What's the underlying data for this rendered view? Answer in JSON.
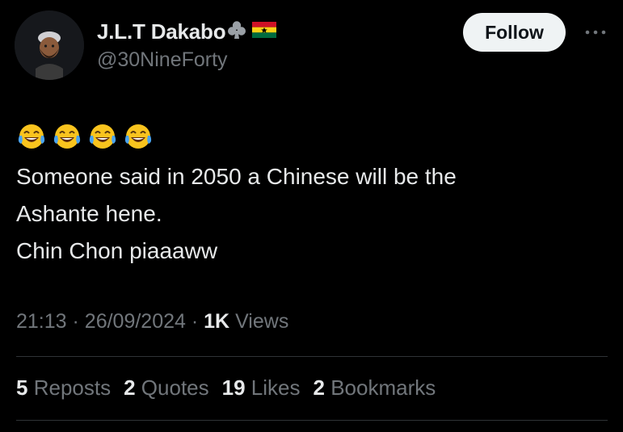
{
  "author": {
    "display_name": "J.L.T Dakabo",
    "handle": "@30NineForty",
    "badges": [
      "club-icon",
      "ghana-flag-icon"
    ]
  },
  "follow_button": {
    "label": "Follow"
  },
  "more_menu": {
    "icon": "more-horizontal-icon"
  },
  "tweet": {
    "emojis": [
      "face-with-tears-of-joy",
      "face-with-tears-of-joy",
      "face-with-tears-of-joy",
      "face-with-tears-of-joy"
    ],
    "lines": [
      "Someone said in 2050 a Chinese will be the",
      "Ashante hene.",
      "Chin Chon piaaaww"
    ]
  },
  "meta": {
    "time": "21:13",
    "separator": "·",
    "date": "26/09/2024",
    "views_count": "1K",
    "views_label": "Views"
  },
  "stats": [
    {
      "count": "5",
      "label": "Reposts"
    },
    {
      "count": "2",
      "label": "Quotes"
    },
    {
      "count": "19",
      "label": "Likes"
    },
    {
      "count": "2",
      "label": "Bookmarks"
    }
  ],
  "colors": {
    "background": "#000000",
    "primary_text": "#e7e9ea",
    "secondary_text": "#71767b",
    "divider": "#2f3336",
    "follow_bg": "#eff3f4"
  }
}
